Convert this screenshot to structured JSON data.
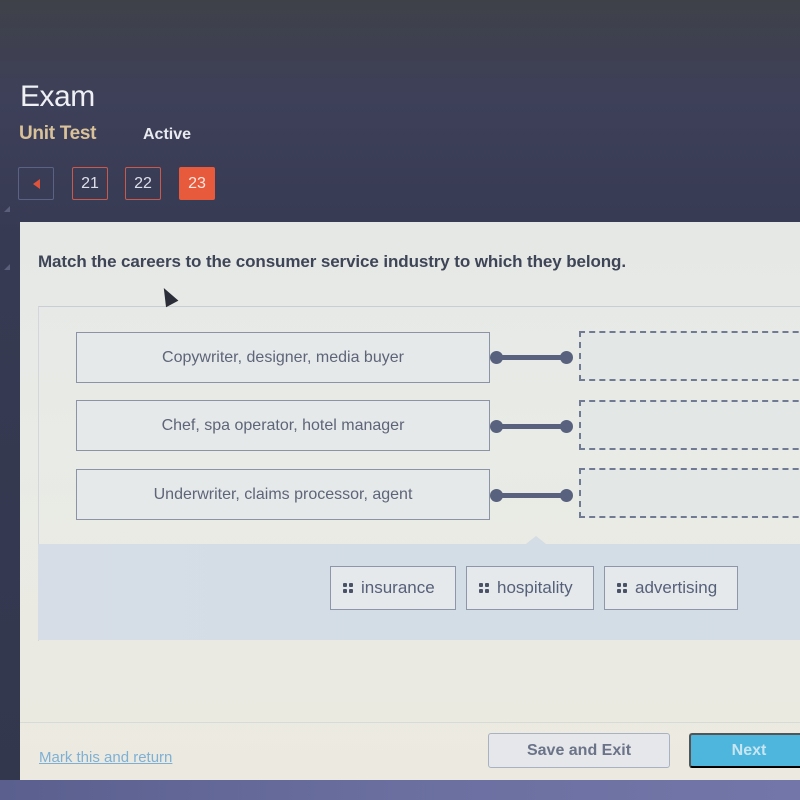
{
  "header": {
    "title": "Exam",
    "subtitle": "Unit Test",
    "status": "Active"
  },
  "nav": {
    "back_icon": "left-triangle-arrow",
    "questions": [
      {
        "number": "21",
        "state": "visited"
      },
      {
        "number": "22",
        "state": "visited"
      },
      {
        "number": "23",
        "state": "current"
      }
    ]
  },
  "question": {
    "prompt": "Match the careers to the consumer service industry to which they belong.",
    "careers": [
      "Copywriter, designer, media buyer",
      "Chef, spa operator, hotel manager",
      "Underwriter, claims processor, agent"
    ],
    "drop_targets": [
      "",
      "",
      ""
    ],
    "answer_bank": [
      {
        "label": "insurance",
        "icon": "drag-grip-icon"
      },
      {
        "label": "hospitality",
        "icon": "drag-grip-icon"
      },
      {
        "label": "advertising",
        "icon": "drag-grip-icon"
      }
    ]
  },
  "footer": {
    "mark_link": "Mark this and return",
    "save_label": "Save and Exit",
    "next_label": "Next"
  },
  "colors": {
    "accent": "#e75a3c",
    "subtitle": "#d9c19a",
    "next_button": "#4eb6dc",
    "link": "#7fb0d4"
  }
}
